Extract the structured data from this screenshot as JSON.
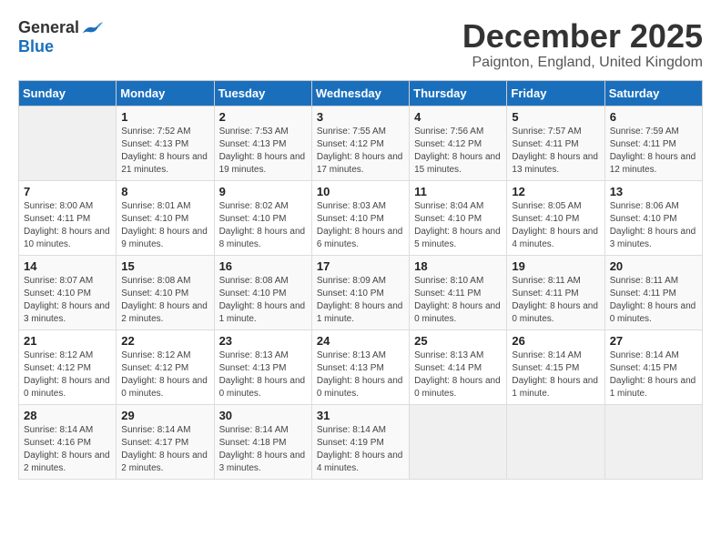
{
  "logo": {
    "general": "General",
    "blue": "Blue"
  },
  "title": "December 2025",
  "location": "Paignton, England, United Kingdom",
  "days_of_week": [
    "Sunday",
    "Monday",
    "Tuesday",
    "Wednesday",
    "Thursday",
    "Friday",
    "Saturday"
  ],
  "weeks": [
    [
      {
        "day": "",
        "sunrise": "",
        "sunset": "",
        "daylight": ""
      },
      {
        "day": "1",
        "sunrise": "Sunrise: 7:52 AM",
        "sunset": "Sunset: 4:13 PM",
        "daylight": "Daylight: 8 hours and 21 minutes."
      },
      {
        "day": "2",
        "sunrise": "Sunrise: 7:53 AM",
        "sunset": "Sunset: 4:13 PM",
        "daylight": "Daylight: 8 hours and 19 minutes."
      },
      {
        "day": "3",
        "sunrise": "Sunrise: 7:55 AM",
        "sunset": "Sunset: 4:12 PM",
        "daylight": "Daylight: 8 hours and 17 minutes."
      },
      {
        "day": "4",
        "sunrise": "Sunrise: 7:56 AM",
        "sunset": "Sunset: 4:12 PM",
        "daylight": "Daylight: 8 hours and 15 minutes."
      },
      {
        "day": "5",
        "sunrise": "Sunrise: 7:57 AM",
        "sunset": "Sunset: 4:11 PM",
        "daylight": "Daylight: 8 hours and 13 minutes."
      },
      {
        "day": "6",
        "sunrise": "Sunrise: 7:59 AM",
        "sunset": "Sunset: 4:11 PM",
        "daylight": "Daylight: 8 hours and 12 minutes."
      }
    ],
    [
      {
        "day": "7",
        "sunrise": "Sunrise: 8:00 AM",
        "sunset": "Sunset: 4:11 PM",
        "daylight": "Daylight: 8 hours and 10 minutes."
      },
      {
        "day": "8",
        "sunrise": "Sunrise: 8:01 AM",
        "sunset": "Sunset: 4:10 PM",
        "daylight": "Daylight: 8 hours and 9 minutes."
      },
      {
        "day": "9",
        "sunrise": "Sunrise: 8:02 AM",
        "sunset": "Sunset: 4:10 PM",
        "daylight": "Daylight: 8 hours and 8 minutes."
      },
      {
        "day": "10",
        "sunrise": "Sunrise: 8:03 AM",
        "sunset": "Sunset: 4:10 PM",
        "daylight": "Daylight: 8 hours and 6 minutes."
      },
      {
        "day": "11",
        "sunrise": "Sunrise: 8:04 AM",
        "sunset": "Sunset: 4:10 PM",
        "daylight": "Daylight: 8 hours and 5 minutes."
      },
      {
        "day": "12",
        "sunrise": "Sunrise: 8:05 AM",
        "sunset": "Sunset: 4:10 PM",
        "daylight": "Daylight: 8 hours and 4 minutes."
      },
      {
        "day": "13",
        "sunrise": "Sunrise: 8:06 AM",
        "sunset": "Sunset: 4:10 PM",
        "daylight": "Daylight: 8 hours and 3 minutes."
      }
    ],
    [
      {
        "day": "14",
        "sunrise": "Sunrise: 8:07 AM",
        "sunset": "Sunset: 4:10 PM",
        "daylight": "Daylight: 8 hours and 3 minutes."
      },
      {
        "day": "15",
        "sunrise": "Sunrise: 8:08 AM",
        "sunset": "Sunset: 4:10 PM",
        "daylight": "Daylight: 8 hours and 2 minutes."
      },
      {
        "day": "16",
        "sunrise": "Sunrise: 8:08 AM",
        "sunset": "Sunset: 4:10 PM",
        "daylight": "Daylight: 8 hours and 1 minute."
      },
      {
        "day": "17",
        "sunrise": "Sunrise: 8:09 AM",
        "sunset": "Sunset: 4:10 PM",
        "daylight": "Daylight: 8 hours and 1 minute."
      },
      {
        "day": "18",
        "sunrise": "Sunrise: 8:10 AM",
        "sunset": "Sunset: 4:11 PM",
        "daylight": "Daylight: 8 hours and 0 minutes."
      },
      {
        "day": "19",
        "sunrise": "Sunrise: 8:11 AM",
        "sunset": "Sunset: 4:11 PM",
        "daylight": "Daylight: 8 hours and 0 minutes."
      },
      {
        "day": "20",
        "sunrise": "Sunrise: 8:11 AM",
        "sunset": "Sunset: 4:11 PM",
        "daylight": "Daylight: 8 hours and 0 minutes."
      }
    ],
    [
      {
        "day": "21",
        "sunrise": "Sunrise: 8:12 AM",
        "sunset": "Sunset: 4:12 PM",
        "daylight": "Daylight: 8 hours and 0 minutes."
      },
      {
        "day": "22",
        "sunrise": "Sunrise: 8:12 AM",
        "sunset": "Sunset: 4:12 PM",
        "daylight": "Daylight: 8 hours and 0 minutes."
      },
      {
        "day": "23",
        "sunrise": "Sunrise: 8:13 AM",
        "sunset": "Sunset: 4:13 PM",
        "daylight": "Daylight: 8 hours and 0 minutes."
      },
      {
        "day": "24",
        "sunrise": "Sunrise: 8:13 AM",
        "sunset": "Sunset: 4:13 PM",
        "daylight": "Daylight: 8 hours and 0 minutes."
      },
      {
        "day": "25",
        "sunrise": "Sunrise: 8:13 AM",
        "sunset": "Sunset: 4:14 PM",
        "daylight": "Daylight: 8 hours and 0 minutes."
      },
      {
        "day": "26",
        "sunrise": "Sunrise: 8:14 AM",
        "sunset": "Sunset: 4:15 PM",
        "daylight": "Daylight: 8 hours and 1 minute."
      },
      {
        "day": "27",
        "sunrise": "Sunrise: 8:14 AM",
        "sunset": "Sunset: 4:15 PM",
        "daylight": "Daylight: 8 hours and 1 minute."
      }
    ],
    [
      {
        "day": "28",
        "sunrise": "Sunrise: 8:14 AM",
        "sunset": "Sunset: 4:16 PM",
        "daylight": "Daylight: 8 hours and 2 minutes."
      },
      {
        "day": "29",
        "sunrise": "Sunrise: 8:14 AM",
        "sunset": "Sunset: 4:17 PM",
        "daylight": "Daylight: 8 hours and 2 minutes."
      },
      {
        "day": "30",
        "sunrise": "Sunrise: 8:14 AM",
        "sunset": "Sunset: 4:18 PM",
        "daylight": "Daylight: 8 hours and 3 minutes."
      },
      {
        "day": "31",
        "sunrise": "Sunrise: 8:14 AM",
        "sunset": "Sunset: 4:19 PM",
        "daylight": "Daylight: 8 hours and 4 minutes."
      },
      {
        "day": "",
        "sunrise": "",
        "sunset": "",
        "daylight": ""
      },
      {
        "day": "",
        "sunrise": "",
        "sunset": "",
        "daylight": ""
      },
      {
        "day": "",
        "sunrise": "",
        "sunset": "",
        "daylight": ""
      }
    ]
  ]
}
